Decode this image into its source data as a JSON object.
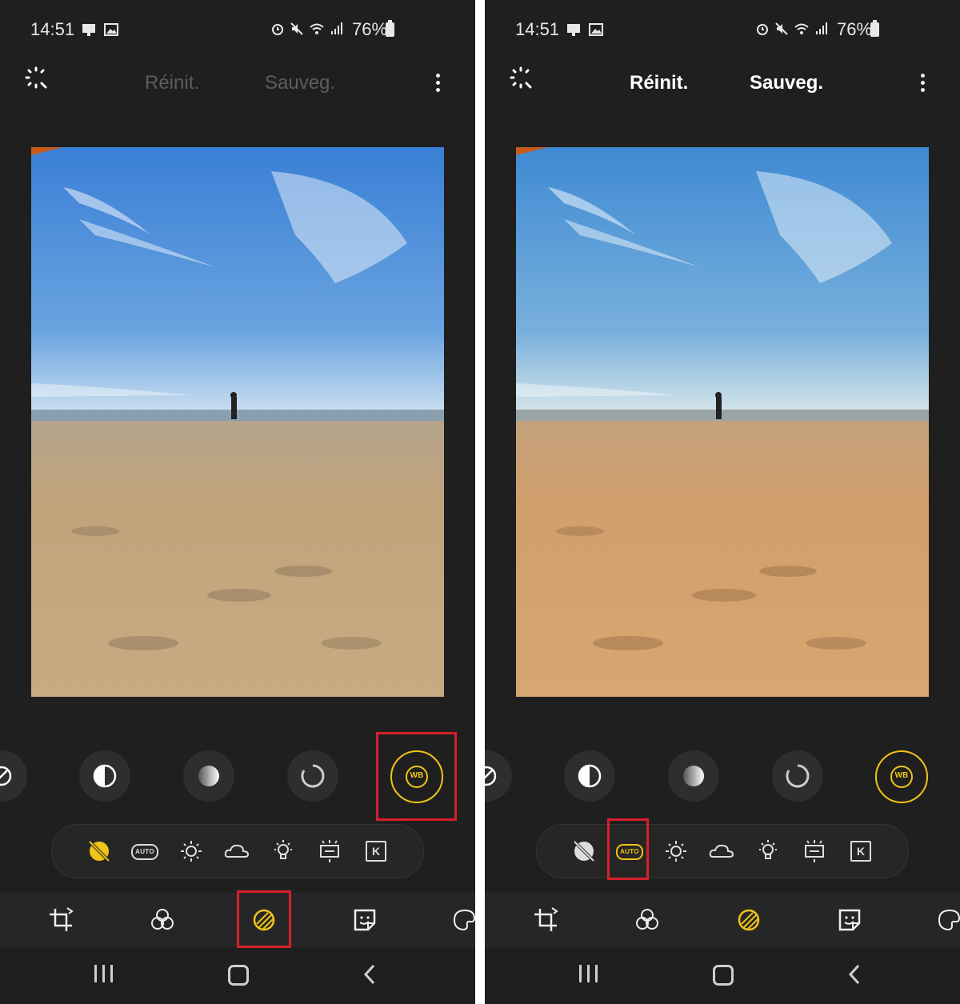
{
  "status": {
    "time": "14:51",
    "battery": "76%"
  },
  "toolbar": {
    "reset_label": "Réinit.",
    "save_label": "Sauveg."
  },
  "presets": {
    "auto_label": "AUTO",
    "kelvin_label": "K"
  },
  "adjustments": {
    "wb_label": "WB"
  },
  "colors": {
    "accent": "#f0c419",
    "highlight": "#d6202a",
    "background": "#1f1f1f"
  },
  "icons": {
    "adjust_row": [
      "exposure-icon",
      "contrast-icon",
      "gradient-icon",
      "saturation-icon",
      "white-balance-icon"
    ],
    "presets": [
      "wb-off-icon",
      "auto-wb-icon",
      "daylight-icon",
      "cloudy-icon",
      "tungsten-icon",
      "fluorescent-icon",
      "kelvin-icon"
    ],
    "bottom_nav": [
      "crop-icon",
      "filters-icon",
      "tone-icon",
      "sticker-icon",
      "draw-icon"
    ]
  }
}
